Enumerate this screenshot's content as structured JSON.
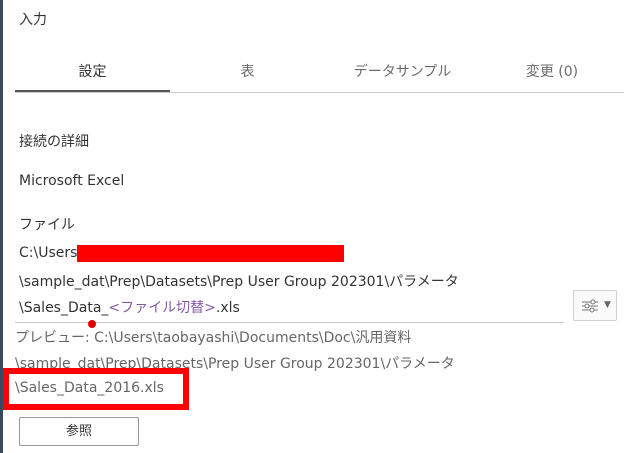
{
  "panel": {
    "title": "入力"
  },
  "tabs": [
    {
      "label": "設定",
      "active": true
    },
    {
      "label": "表",
      "active": false
    },
    {
      "label": "データサンプル",
      "active": false
    },
    {
      "label": "変更 (0)",
      "active": false
    }
  ],
  "connection": {
    "details_label": "接続の詳細",
    "type": "Microsoft Excel"
  },
  "file": {
    "label": "ファイル",
    "path_line1": "C:\\Users",
    "path_line2": "\\sample_dat\\Prep\\Datasets\\Prep User Group 202301\\パラメータ",
    "path_line3_prefix": "\\Sales_Data_",
    "path_line3_param": "<ファイル切替>",
    "path_line3_suffix": ".xls",
    "options_icon": "sliders-icon"
  },
  "preview": {
    "line1": "プレビュー: C:\\Users\\taobayashi\\Documents\\Doc\\汎用資料",
    "line2": "\\sample_dat\\Prep\\Datasets\\Prep User Group 202301\\パラメータ",
    "line3": "\\Sales_Data_2016.xls"
  },
  "browse_button": {
    "label": "参照"
  },
  "colors": {
    "param_text": "#8a58a8",
    "annotation_red": "#ff0000"
  }
}
